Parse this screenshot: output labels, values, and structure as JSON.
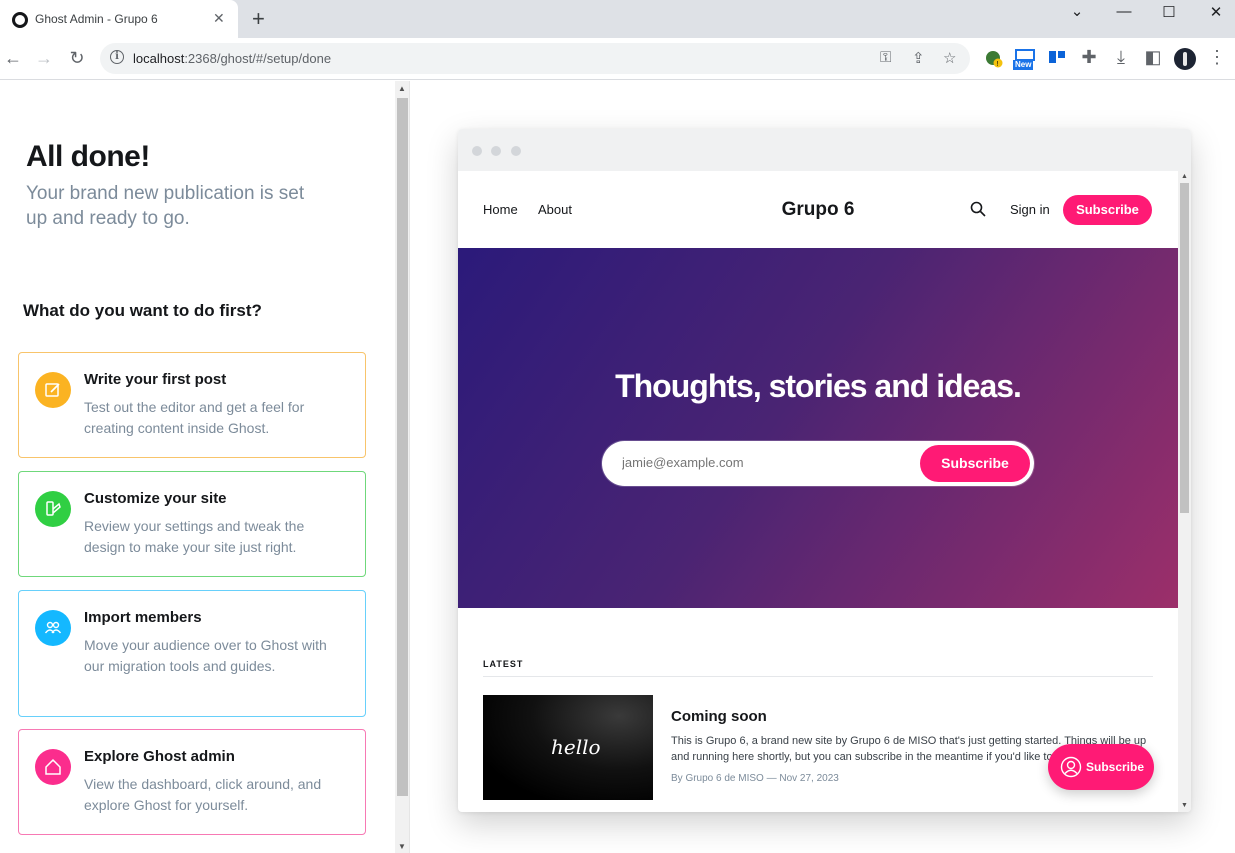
{
  "browser": {
    "tab_title": "Ghost Admin - Grupo 6",
    "url_host": "localhost",
    "url_rest": ":2368/ghost/#/setup/done",
    "ext_badge": "New"
  },
  "setup": {
    "title": "All done!",
    "subtitle": "Your brand new publication is set up and ready to go.",
    "question": "What do you want to do first?",
    "cards": [
      {
        "title": "Write your first post",
        "desc": "Test out the editor and get a feel for creating content inside Ghost.",
        "color": "#fbb322",
        "icon": "pencil-icon"
      },
      {
        "title": "Customize your site",
        "desc": "Review your settings and tweak the design to make your site just right.",
        "color": "#30cf43",
        "icon": "brush-icon"
      },
      {
        "title": "Import members",
        "desc": "Move your audience over to Ghost with our migration tools and guides.",
        "color": "#14b8ff",
        "icon": "members-icon"
      },
      {
        "title": "Explore Ghost admin",
        "desc": "View the dashboard, click around, and explore Ghost for yourself.",
        "color": "#fb2d8d",
        "icon": "home-icon"
      }
    ]
  },
  "site": {
    "nav": [
      "Home",
      "About"
    ],
    "name": "Grupo 6",
    "signin": "Sign in",
    "subscribe": "Subscribe",
    "accent": "#ff1a75",
    "hero_title": "Thoughts, stories and ideas.",
    "email_placeholder": "jamie@example.com",
    "hero_button": "Subscribe",
    "latest_label": "LATEST",
    "post": {
      "image_text": "hello",
      "title": "Coming soon",
      "excerpt": "This is Grupo 6, a brand new site by Grupo 6 de MISO that's just getting started. Things will be up and running here shortly, but you can subscribe in the meantime if you'd like to stay up to date and receive emails when new content is published!",
      "meta": "By Grupo 6 de MISO — Nov 27, 2023"
    },
    "float_subscribe": "Subscribe"
  }
}
